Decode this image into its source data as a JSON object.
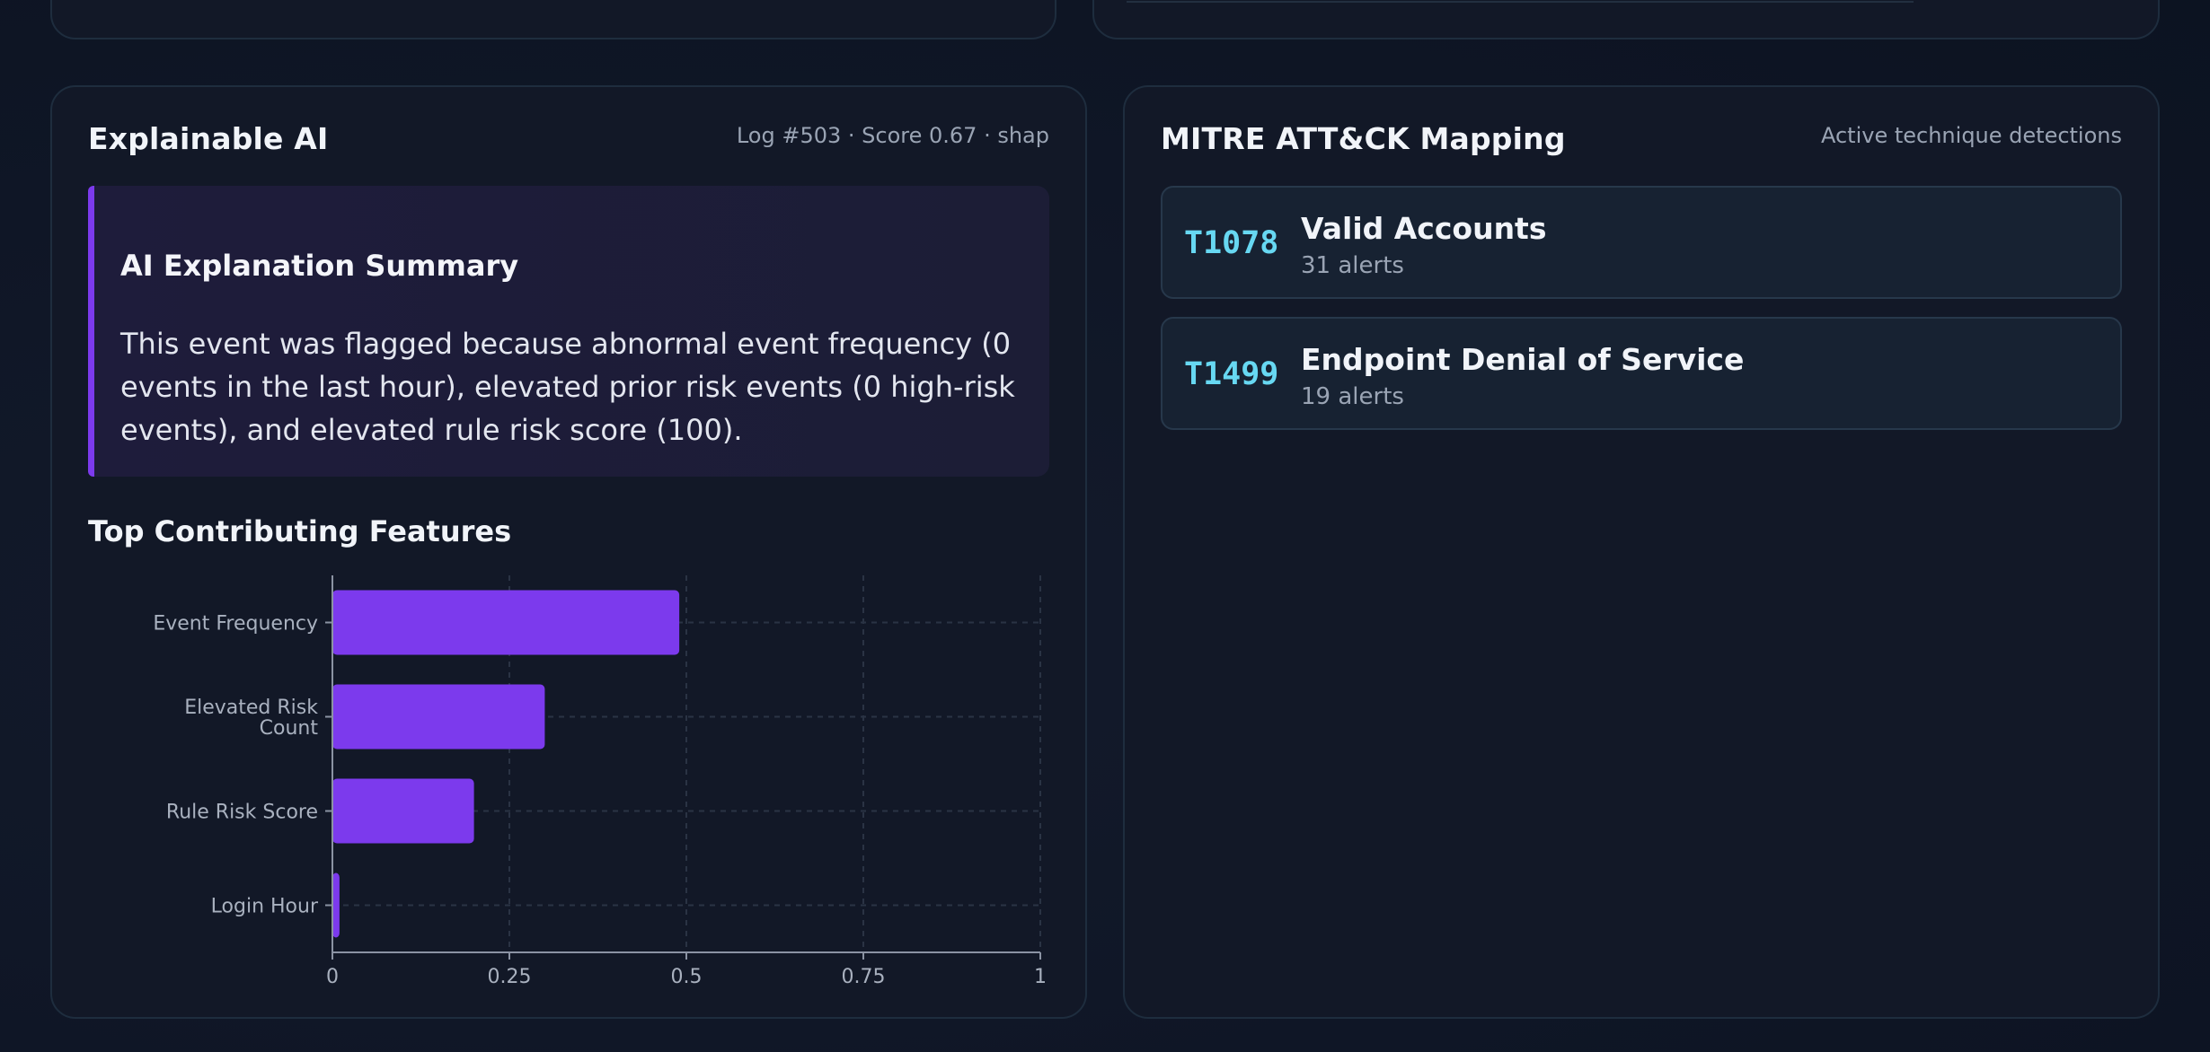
{
  "xai_card": {
    "title": "Explainable AI",
    "meta": "Log #503 · Score 0.67 · shap",
    "summary": {
      "title": "AI Explanation Summary",
      "text": "This event was flagged because abnormal event frequency (0 events in the last hour), elevated prior risk events (0 high-risk events), and elevated rule risk score (100)."
    },
    "features_title": "Top Contributing Features"
  },
  "chart_data": {
    "type": "bar",
    "orientation": "horizontal",
    "categories": [
      "Event Frequency",
      "Elevated Risk Count",
      "Rule Risk Score",
      "Login Hour"
    ],
    "category_label_lines": [
      [
        "Event Frequency"
      ],
      [
        "Elevated Risk",
        "Count"
      ],
      [
        "Rule Risk Score"
      ],
      [
        "Login Hour"
      ]
    ],
    "values": [
      0.49,
      0.3,
      0.2,
      0.01
    ],
    "xlim": [
      0,
      1
    ],
    "x_ticks": [
      "0",
      "0.25",
      "0.5",
      "0.75",
      "1"
    ],
    "grid": true,
    "bar_color": "#7c3aed"
  },
  "mitre_card": {
    "title": "MITRE ATT&CK Mapping",
    "meta": "Active technique detections",
    "techniques": [
      {
        "id": "T1078",
        "name": "Valid Accounts",
        "count": "31 alerts"
      },
      {
        "id": "T1499",
        "name": "Endpoint Denial of Service",
        "count": "19 alerts"
      }
    ]
  },
  "colors": {
    "accent": "#7c3aed",
    "technique_id": "#67d8f2"
  }
}
